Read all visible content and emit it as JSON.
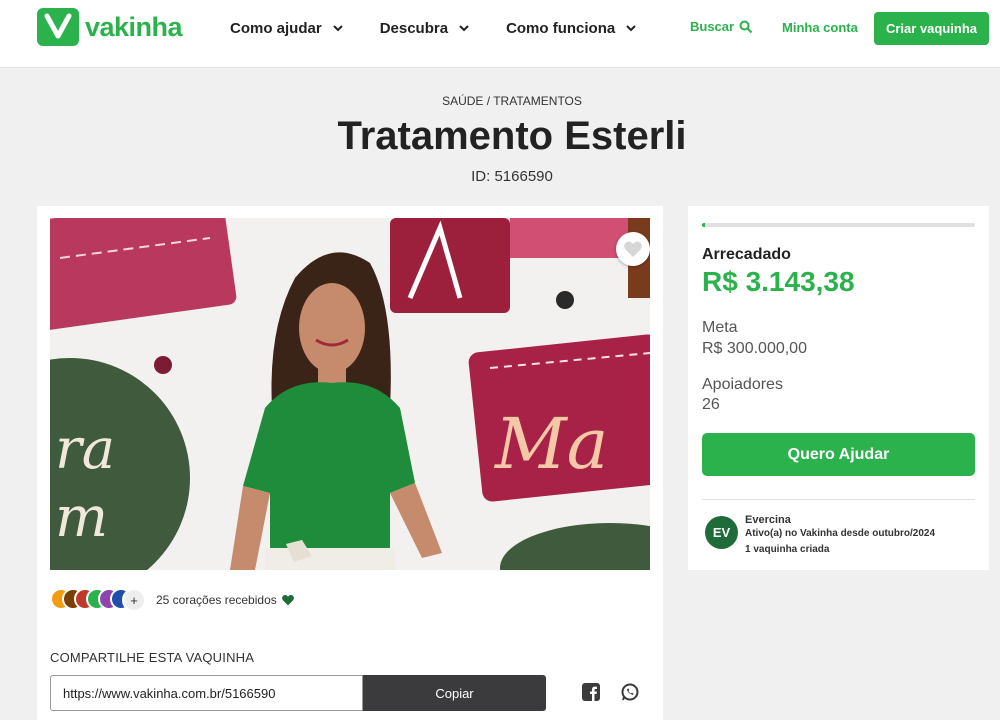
{
  "header": {
    "logo_text": "vakinha",
    "nav": [
      {
        "label": "Como ajudar"
      },
      {
        "label": "Descubra"
      },
      {
        "label": "Como funciona"
      }
    ],
    "search_label": "Buscar",
    "account_label": "Minha conta",
    "create_label": "Criar vaquinha",
    "brand_color": "#2bb24c"
  },
  "campaign": {
    "category": "SAÚDE / TRATAMENTOS",
    "title": "Tratamento Esterli",
    "id_label": "ID: 5166590"
  },
  "media": {
    "hearts_text": "25 corações recebidos",
    "plus_label": "+",
    "avatar_colors": [
      "#f39c12",
      "#7b3f00",
      "#c0392b",
      "#2bb24c",
      "#8e44ad",
      "#1f4fa8"
    ]
  },
  "share": {
    "title": "COMPARTILHE ESTA VAQUINHA",
    "url": "https://www.vakinha.com.br/5166590",
    "copy_label": "Copiar"
  },
  "stats": {
    "progress_fraction": 0.0105,
    "raised_label": "Arrecadado",
    "raised_value": "R$ 3.143,38",
    "goal_label": "Meta",
    "goal_value": "R$ 300.000,00",
    "supporters_label": "Apoiadores",
    "supporters_value": "26",
    "help_label": "Quero Ajudar"
  },
  "organizer": {
    "initials": "EV",
    "name": "Evercina",
    "since": "Ativo(a) no Vakinha desde outubro/2024",
    "count": "1 vaquinha criada"
  }
}
